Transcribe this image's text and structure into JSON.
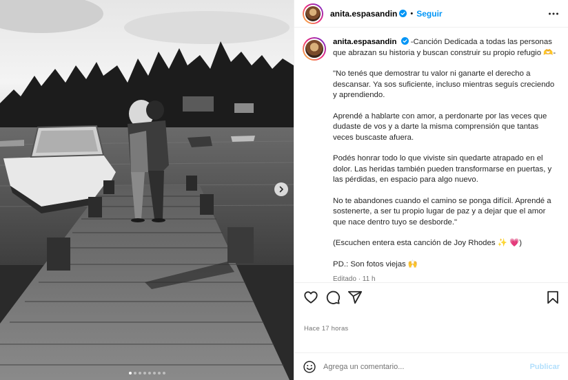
{
  "post": {
    "username": "anita.espasandin",
    "follow_label": "Seguir",
    "separator": "•",
    "carousel": {
      "dot_count": 8,
      "active_dot": 0
    }
  },
  "caption": {
    "username": "anita.espasandin",
    "first_line": "-Canción Dedicada a todas las personas que abrazan su historia y buscan construir su propio refugio 🫶-",
    "paragraphs": [
      "\"No tenés que demostrar tu valor ni ganarte el derecho a descansar. Ya sos suficiente, incluso mientras seguís creciendo y aprendiendo.",
      "Aprendé a hablarte con amor, a perdonarte por las veces que dudaste de vos y a darte la misma comprensión que tantas veces buscaste afuera.",
      "Podés honrar todo lo que viviste sin quedarte atrapado en el dolor. Las heridas también pueden transformarse en puertas, y las pérdidas, en espacio para algo nuevo.",
      "No te abandones cuando el camino se ponga difícil. Aprendé a sostenerte, a ser tu propio lugar de paz y a dejar que el amor que nace dentro tuyo se desborde.\"",
      "(Escuchen entera esta canción de Joy Rhodes ✨ 💗)",
      "PD.: Son fotos viejas 🙌"
    ],
    "meta": "Editado · 11 h"
  },
  "footer": {
    "time": "Hace 17 horas",
    "comment_placeholder": "Agrega un comentario...",
    "publish_label": "Publicar"
  },
  "icons": {
    "like": "heart-icon",
    "comment": "comment-icon",
    "share": "send-icon",
    "save": "bookmark-icon",
    "more": "more-horizontal-icon",
    "verified": "verified-badge-icon",
    "next": "chevron-right-icon",
    "emoji": "emoji-icon"
  },
  "colors": {
    "accent": "#0095f6",
    "publish_disabled": "#b2dffc",
    "muted": "#737373"
  }
}
